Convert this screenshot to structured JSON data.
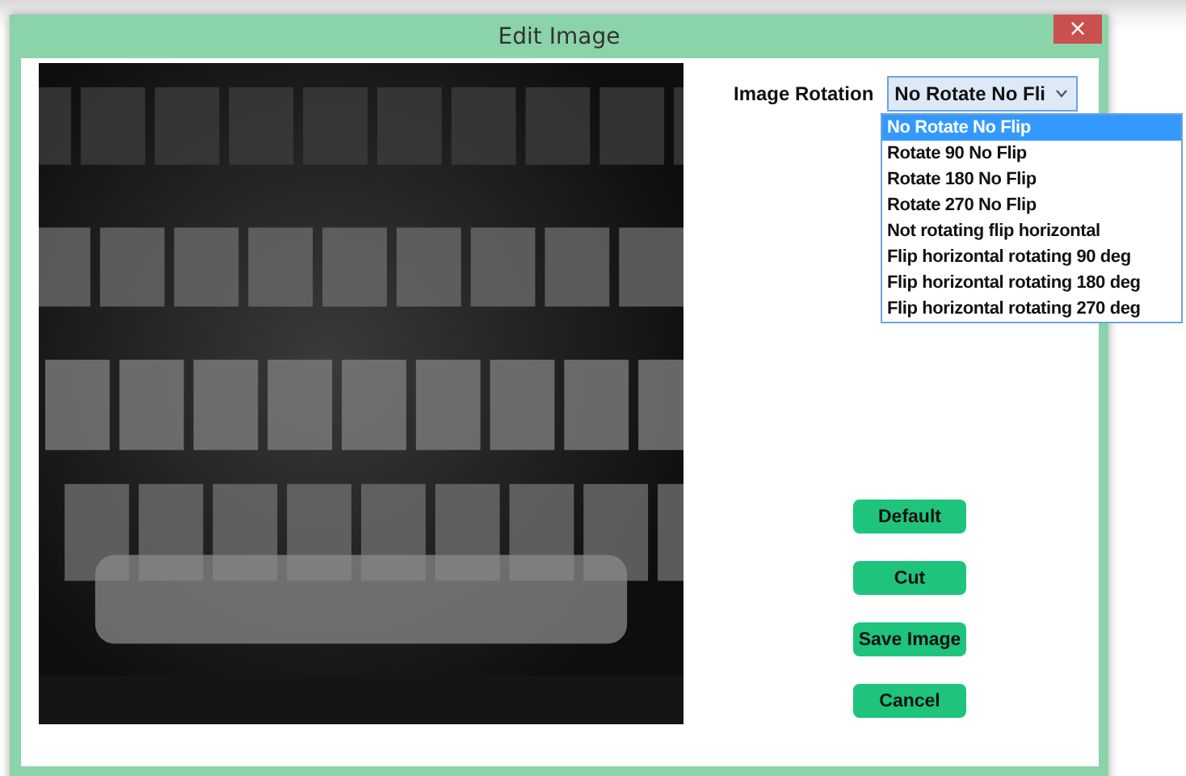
{
  "window": {
    "title": "Edit Image",
    "close": "×"
  },
  "rotation": {
    "label": "Image Rotation",
    "value": "No Rotate No Fli",
    "expanded": true,
    "options": [
      {
        "label": "No Rotate No Flip",
        "selected": true
      },
      {
        "label": "Rotate 90 No Flip",
        "selected": false
      },
      {
        "label": "Rotate 180 No Flip",
        "selected": false
      },
      {
        "label": "Rotate 270 No Flip",
        "selected": false
      },
      {
        "label": "Not rotating flip horizontal",
        "selected": false
      },
      {
        "label": "Flip horizontal rotating 90 deg",
        "selected": false
      },
      {
        "label": "Flip horizontal rotating 180 deg",
        "selected": false
      },
      {
        "label": "Flip horizontal rotating 270 deg",
        "selected": false
      }
    ]
  },
  "buttons": [
    "Default",
    "Cut",
    "Save Image",
    "Cancel"
  ]
}
